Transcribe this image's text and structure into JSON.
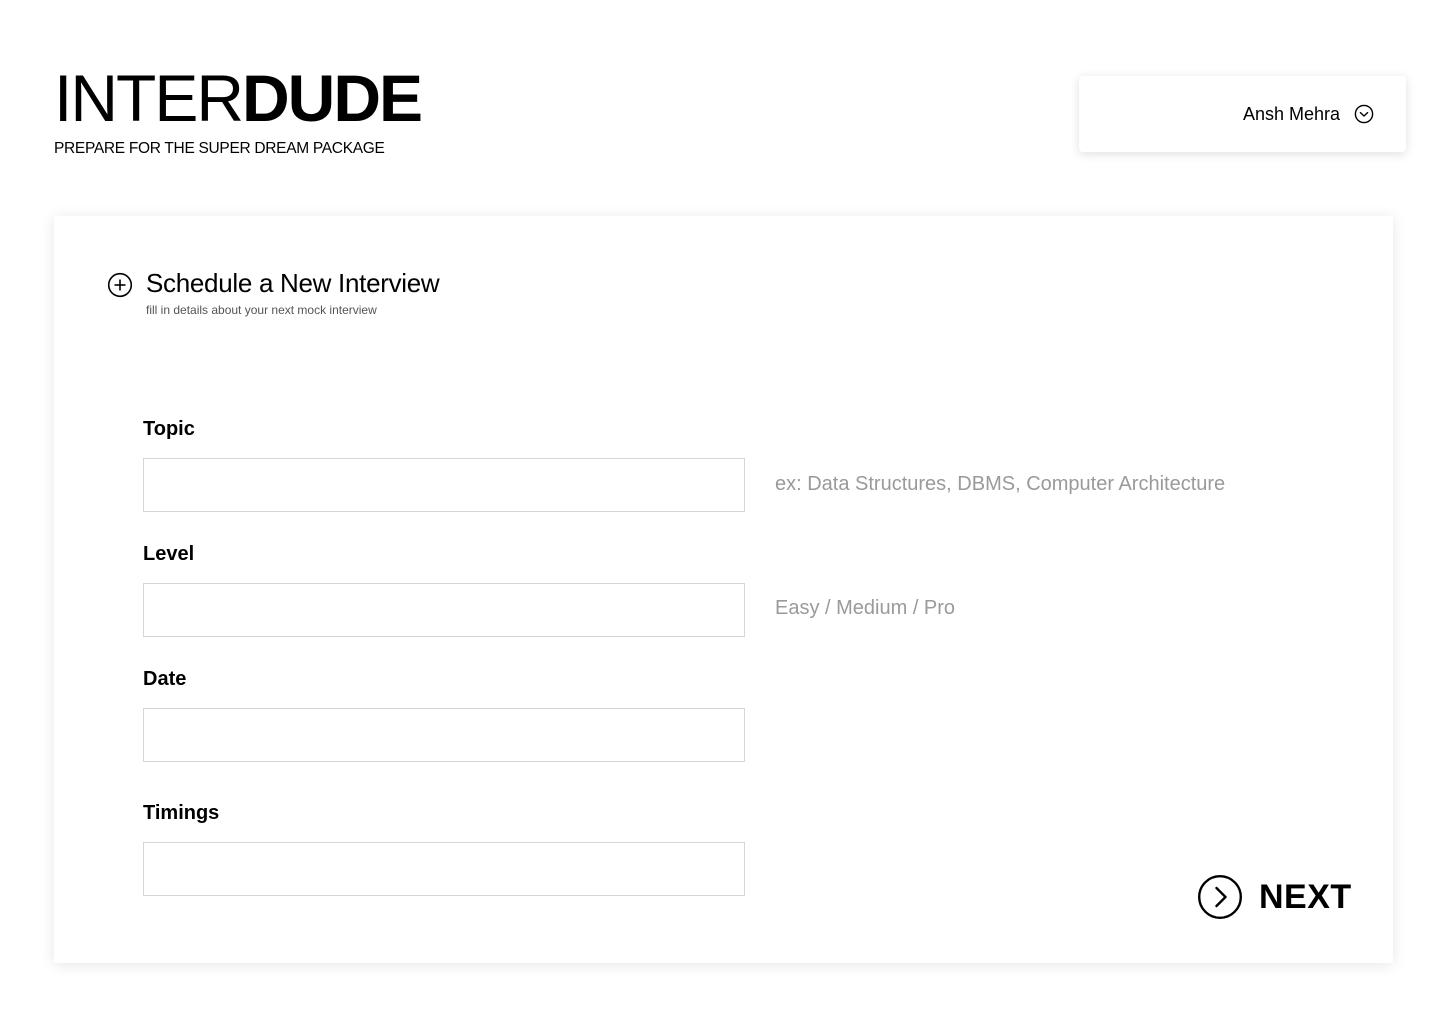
{
  "brand": {
    "logo_light": "INTER",
    "logo_bold": "DUDE",
    "tagline": "PREPARE FOR THE SUPER DREAM PACKAGE"
  },
  "user_menu": {
    "name": "Ansh Mehra",
    "icon": "chevron-down-circle-icon"
  },
  "form": {
    "icon": "plus-circle-icon",
    "title": "Schedule a New Interview",
    "subtitle": "fill in details about your next mock interview",
    "fields": [
      {
        "label": "Topic",
        "value": "",
        "hint": "ex: Data Structures, DBMS, Computer Architecture"
      },
      {
        "label": "Level",
        "value": "",
        "hint": "Easy / Medium / Pro"
      },
      {
        "label": "Date",
        "value": ""
      },
      {
        "label": "Timings",
        "value": ""
      }
    ],
    "next": {
      "label": "NEXT",
      "icon": "chevron-right-circle-icon"
    }
  }
}
